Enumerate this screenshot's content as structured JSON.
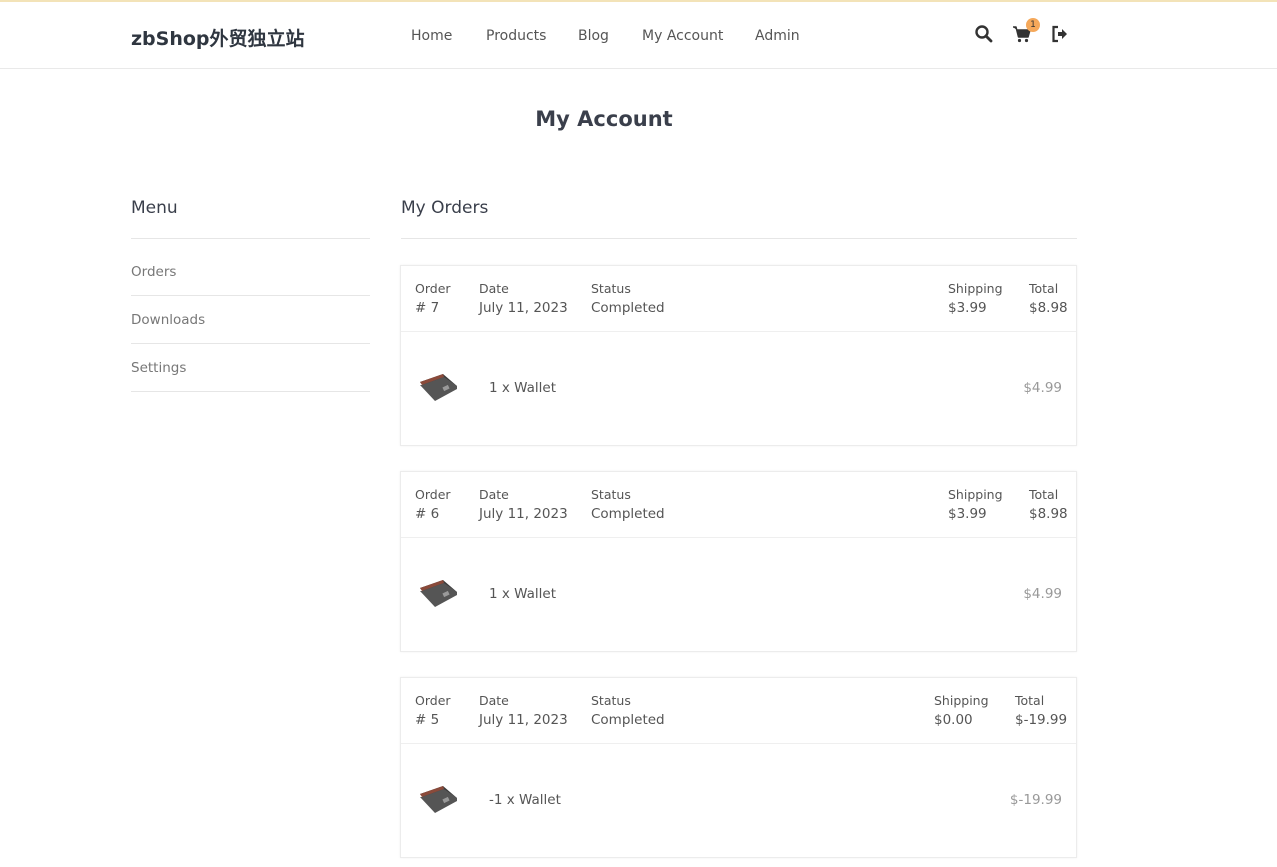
{
  "header": {
    "brand": "zbShop外贸独立站",
    "nav": [
      {
        "label": "Home"
      },
      {
        "label": "Products"
      },
      {
        "label": "Blog"
      },
      {
        "label": "My Account"
      },
      {
        "label": "Admin"
      }
    ],
    "cart_count": "1",
    "icons": [
      "search-icon",
      "cart-icon",
      "logout-icon"
    ]
  },
  "page": {
    "title": "My Account"
  },
  "sidebar": {
    "title": "Menu",
    "items": [
      {
        "label": "Orders"
      },
      {
        "label": "Downloads"
      },
      {
        "label": "Settings"
      }
    ]
  },
  "orders": {
    "title": "My Orders",
    "labels": {
      "order": "Order",
      "date": "Date",
      "status": "Status",
      "shipping": "Shipping",
      "total": "Total"
    },
    "list": [
      {
        "number": "# 7",
        "date": "July 11, 2023",
        "status": "Completed",
        "shipping": "$3.99",
        "total": "$8.98",
        "item": "1 x Wallet",
        "item_price": "$4.99"
      },
      {
        "number": "# 6",
        "date": "July 11, 2023",
        "status": "Completed",
        "shipping": "$3.99",
        "total": "$8.98",
        "item": "1 x Wallet",
        "item_price": "$4.99"
      },
      {
        "number": "# 5",
        "date": "July 11, 2023",
        "status": "Completed",
        "shipping": "$0.00",
        "total": "$-19.99",
        "item": "-1 x Wallet",
        "item_price": "$-19.99"
      }
    ]
  },
  "colors": {
    "accent_badge": "#f5a85a",
    "text_dark": "#3a3f4b",
    "border": "#ececec"
  }
}
